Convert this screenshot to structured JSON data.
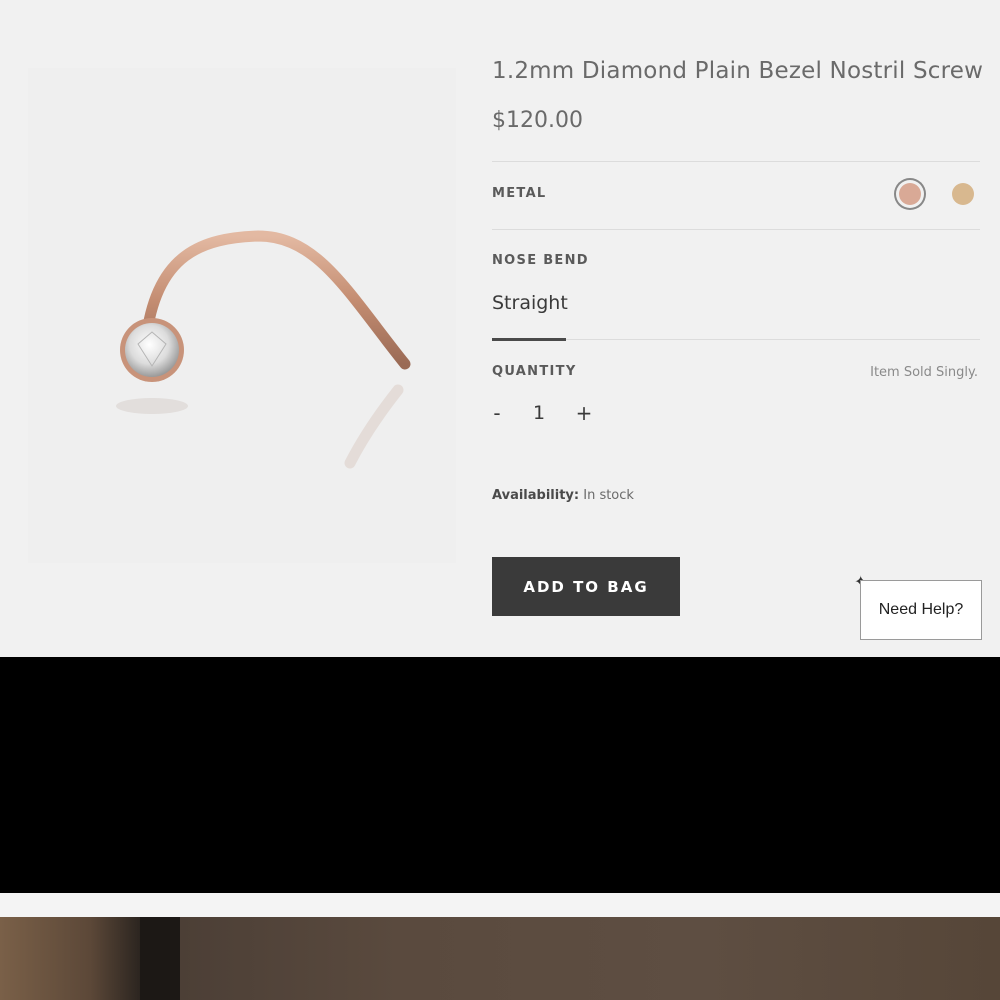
{
  "product": {
    "title": "1.2mm Diamond Plain Bezel Nostril Screw",
    "price": "$120.00"
  },
  "metal": {
    "label": "METAL",
    "options": [
      {
        "name": "rose-gold",
        "color": "#d9a996",
        "selected": true
      },
      {
        "name": "yellow-gold",
        "color": "#d8b88f",
        "selected": false
      }
    ]
  },
  "nose_bend": {
    "label": "NOSE BEND",
    "value": "Straight"
  },
  "quantity": {
    "label": "QUANTITY",
    "note": "Item Sold Singly.",
    "decrement": "-",
    "value": "1",
    "increment": "+"
  },
  "availability": {
    "label": "Availability:",
    "value": "In stock"
  },
  "actions": {
    "add_to_bag": "ADD TO BAG",
    "need_help": "Need Help?"
  },
  "colors": {
    "button_bg": "#3a3a3a",
    "panel_bg": "#f1f1f1",
    "metal_rose": "#c8937a"
  }
}
